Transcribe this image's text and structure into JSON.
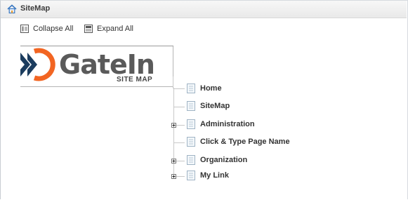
{
  "header": {
    "title": "SiteMap",
    "icon": "home-icon"
  },
  "toolbar": {
    "collapse_label": "Collapse All",
    "expand_label": "Expand All"
  },
  "logo": {
    "wordmark": "GateIn",
    "subtitle": "SITE MAP"
  },
  "tree": {
    "nodes": [
      {
        "label": "Home",
        "expandable": false
      },
      {
        "label": "SiteMap",
        "expandable": false
      },
      {
        "label": "Administration",
        "expandable": true
      },
      {
        "label": "Click & Type Page Name",
        "expandable": false
      },
      {
        "label": "Organization",
        "expandable": true
      },
      {
        "label": "My Link",
        "expandable": true
      }
    ]
  },
  "colors": {
    "logo_orange": "#f26522",
    "logo_navy": "#1b3c5e",
    "text": "#333333"
  }
}
